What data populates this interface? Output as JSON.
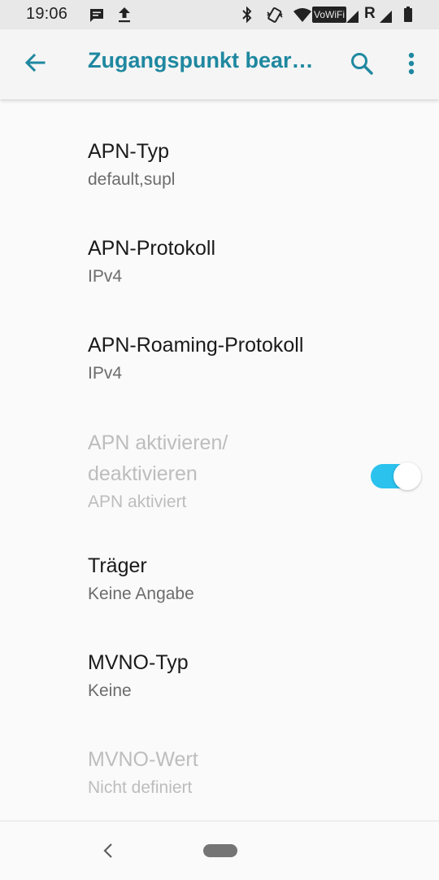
{
  "status_bar": {
    "time": "19:06",
    "vowifi_label": "VoWiFi",
    "roaming_label": "R",
    "icons": [
      "message-icon",
      "upload-icon",
      "bluetooth-icon",
      "vibrate-icon",
      "wifi-icon",
      "signal-icon",
      "battery-icon"
    ]
  },
  "app_bar": {
    "title": "Zugangspunkt bear…",
    "icons": [
      "back-arrow-icon",
      "search-icon",
      "more-vert-icon"
    ],
    "accent_color": "#1f88a0"
  },
  "preferences": {
    "apn_type": {
      "title": "APN-Typ",
      "summary": "default,supl"
    },
    "apn_protocol": {
      "title": "APN-Protokoll",
      "summary": "IPv4"
    },
    "apn_roaming_protocol": {
      "title": "APN-Roaming-Protokoll",
      "summary": "IPv4"
    },
    "apn_enable": {
      "title_line1": "APN aktivieren/",
      "title_line2": "deaktivieren",
      "summary": "APN aktiviert",
      "switch_on": true,
      "switch_color": "#2bc2ee"
    },
    "bearer": {
      "title": "Träger",
      "summary": "Keine Angabe"
    },
    "mvno_type": {
      "title": "MVNO-Typ",
      "summary": "Keine"
    },
    "mvno_value": {
      "title": "MVNO-Wert",
      "summary": "Nicht definiert"
    }
  },
  "nav_bar": {
    "icons": [
      "nav-back-icon",
      "home-pill-icon"
    ]
  }
}
